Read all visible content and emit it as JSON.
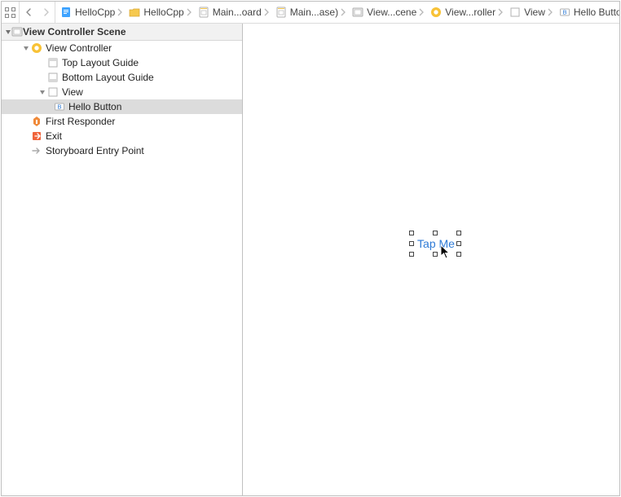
{
  "pathbar": {
    "crumbs": [
      {
        "label": "HelloCpp",
        "icon": "file-blue"
      },
      {
        "label": "HelloCpp",
        "icon": "folder-yellow"
      },
      {
        "label": "Main...oard",
        "icon": "file-gray"
      },
      {
        "label": "Main...ase)",
        "icon": "file-gray"
      },
      {
        "label": "View...cene",
        "icon": "scene-gray"
      },
      {
        "label": "View...roller",
        "icon": "vc-yellow"
      },
      {
        "label": "View",
        "icon": "view-gray"
      },
      {
        "label": "Hello Button",
        "icon": "button-blue"
      }
    ]
  },
  "outline": {
    "header": "View Controller Scene",
    "rows": [
      {
        "label": "View Controller",
        "icon": "vc-yellow",
        "indent": 1,
        "disclosure": "down"
      },
      {
        "label": "Top Layout Guide",
        "icon": "guide-gray",
        "indent": 2,
        "disclosure": ""
      },
      {
        "label": "Bottom Layout Guide",
        "icon": "guide-gray",
        "indent": 2,
        "disclosure": ""
      },
      {
        "label": "View",
        "icon": "view-gray",
        "indent": 2,
        "disclosure": "down"
      },
      {
        "label": "Hello Button",
        "icon": "button-blue",
        "indent": 4,
        "disclosure": "",
        "selected": true
      },
      {
        "label": "First Responder",
        "icon": "first-responder",
        "indent": 1,
        "disclosure": ""
      },
      {
        "label": "Exit",
        "icon": "exit",
        "indent": 1,
        "disclosure": ""
      },
      {
        "label": "Storyboard Entry Point",
        "icon": "entry-arrow",
        "indent": 1,
        "disclosure": ""
      }
    ]
  },
  "canvas": {
    "button_label": "Tap Me"
  }
}
